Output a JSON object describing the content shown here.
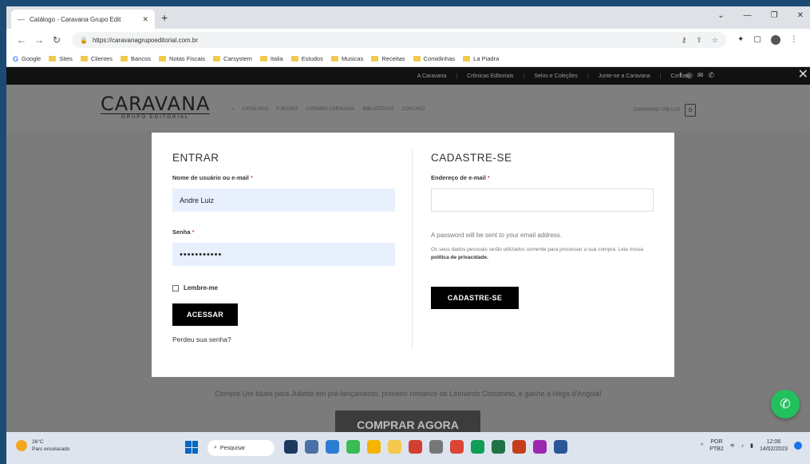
{
  "browser": {
    "tab_title": "Catálogo - Caravana Grupo Edit",
    "tab_close": "✕",
    "new_tab": "+",
    "url": "https://caravanagrupoeditorial.com.br",
    "bookmarks": [
      {
        "label": "Google",
        "icon": "google-icon"
      },
      {
        "label": "Sites",
        "icon": "folder-icon"
      },
      {
        "label": "Clientes",
        "icon": "folder-icon"
      },
      {
        "label": "Bancos",
        "icon": "folder-icon"
      },
      {
        "label": "Notas Fiscais",
        "icon": "folder-icon"
      },
      {
        "label": "Carsystem",
        "icon": "folder-icon"
      },
      {
        "label": "Italia",
        "icon": "folder-icon"
      },
      {
        "label": "Estudos",
        "icon": "folder-icon"
      },
      {
        "label": "Musicas",
        "icon": "folder-icon"
      },
      {
        "label": "Receitas",
        "icon": "folder-icon"
      },
      {
        "label": "Comidinhas",
        "icon": "folder-icon"
      },
      {
        "label": "La Piadra",
        "icon": "folder-icon"
      }
    ]
  },
  "site": {
    "topbar_links": [
      "A Caravana",
      "Crônicas Editoriais",
      "Selos e Coleções",
      "Junte-se a Caravana",
      "Contato"
    ],
    "logo_main": "CARAVANA",
    "logo_sub": "GRUPO EDITORIAL",
    "nav": [
      "CATÁLOGO",
      "E-BOOKS",
      "LIVRARIA CARAVANA",
      "BIBLIOTECAS",
      "CONTATO"
    ],
    "cart_label": "CARRINHO / R$ 0,00",
    "cart_count": "0",
    "promo_text": "Compre Um blues para Juliette em pré-lançamento, primeiro romance de Leonardo Costaneto, e ganhe a Héga d'Angola!",
    "buy_button": "COMPRAR AGORA"
  },
  "login": {
    "heading": "ENTRAR",
    "username_label": "Nome de usuário ou e-mail",
    "username_value": "Andre Luiz",
    "password_label": "Senha",
    "password_value": "•••••••••••",
    "required_mark": "*",
    "remember_label": "Lembre-me",
    "submit_label": "ACESSAR",
    "lost_password": "Perdeu sua senha?"
  },
  "register": {
    "heading": "CADASTRE-SE",
    "email_label": "Endereço de e-mail",
    "email_value": "",
    "info": "A password will be sent to your email address.",
    "privacy_text": "Os seus dados pessoais serão utilizados somente para processar a sua compra. Leia nossa",
    "privacy_link": "política de privacidade.",
    "submit_label": "CADASTRE-SE"
  },
  "taskbar": {
    "weather_temp": "26°C",
    "weather_desc": "Parc ensolarado",
    "search_label": "Pesquisar",
    "lang_top": "POR",
    "lang_bottom": "PTB2",
    "time": "12:06",
    "date": "14/02/2023"
  }
}
